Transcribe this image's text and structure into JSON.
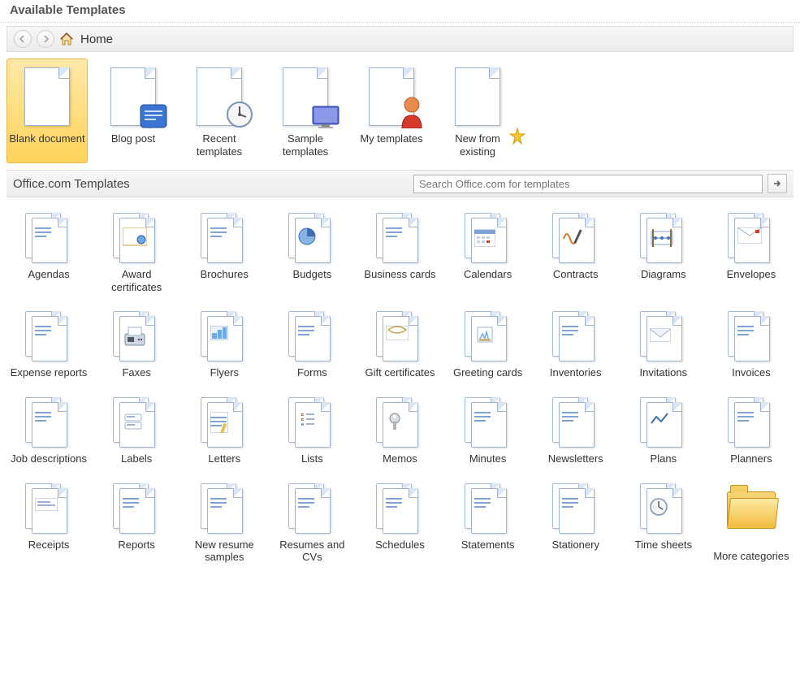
{
  "header": {
    "title": "Available Templates"
  },
  "breadcrumb": {
    "home_label": "Home"
  },
  "top_templates": [
    {
      "id": "blank-document",
      "label": "Blank document",
      "selected": true
    },
    {
      "id": "blog-post",
      "label": "Blog post"
    },
    {
      "id": "recent",
      "label": "Recent templates"
    },
    {
      "id": "sample",
      "label": "Sample templates"
    },
    {
      "id": "my-templates",
      "label": "My templates"
    },
    {
      "id": "new-from-existing",
      "label": "New from existing"
    }
  ],
  "office_section": {
    "title": "Office.com Templates",
    "search_placeholder": "Search Office.com for templates"
  },
  "categories": [
    {
      "id": "agendas",
      "label": "Agendas"
    },
    {
      "id": "award-certificates",
      "label": "Award certificates"
    },
    {
      "id": "brochures",
      "label": "Brochures"
    },
    {
      "id": "budgets",
      "label": "Budgets"
    },
    {
      "id": "business-cards",
      "label": "Business cards"
    },
    {
      "id": "calendars",
      "label": "Calendars"
    },
    {
      "id": "contracts",
      "label": "Contracts"
    },
    {
      "id": "diagrams",
      "label": "Diagrams"
    },
    {
      "id": "envelopes",
      "label": "Envelopes"
    },
    {
      "id": "expense-reports",
      "label": "Expense reports"
    },
    {
      "id": "faxes",
      "label": "Faxes"
    },
    {
      "id": "flyers",
      "label": "Flyers"
    },
    {
      "id": "forms",
      "label": "Forms"
    },
    {
      "id": "gift-certificates",
      "label": "Gift certificates"
    },
    {
      "id": "greeting-cards",
      "label": "Greeting cards"
    },
    {
      "id": "inventories",
      "label": "Inventories"
    },
    {
      "id": "invitations",
      "label": "Invitations"
    },
    {
      "id": "invoices",
      "label": "Invoices"
    },
    {
      "id": "job-descriptions",
      "label": "Job descriptions"
    },
    {
      "id": "labels",
      "label": "Labels"
    },
    {
      "id": "letters",
      "label": "Letters"
    },
    {
      "id": "lists",
      "label": "Lists"
    },
    {
      "id": "memos",
      "label": "Memos"
    },
    {
      "id": "minutes",
      "label": "Minutes"
    },
    {
      "id": "newsletters",
      "label": "Newsletters"
    },
    {
      "id": "plans",
      "label": "Plans"
    },
    {
      "id": "planners",
      "label": "Planners"
    },
    {
      "id": "receipts",
      "label": "Receipts"
    },
    {
      "id": "reports",
      "label": "Reports"
    },
    {
      "id": "new-resume-samples",
      "label": "New resume samples"
    },
    {
      "id": "resumes-cvs",
      "label": "Resumes and CVs"
    },
    {
      "id": "schedules",
      "label": "Schedules"
    },
    {
      "id": "statements",
      "label": "Statements"
    },
    {
      "id": "stationery",
      "label": "Stationery"
    },
    {
      "id": "time-sheets",
      "label": "Time sheets"
    },
    {
      "id": "more-categories",
      "label": "More categories",
      "folder": true
    }
  ]
}
